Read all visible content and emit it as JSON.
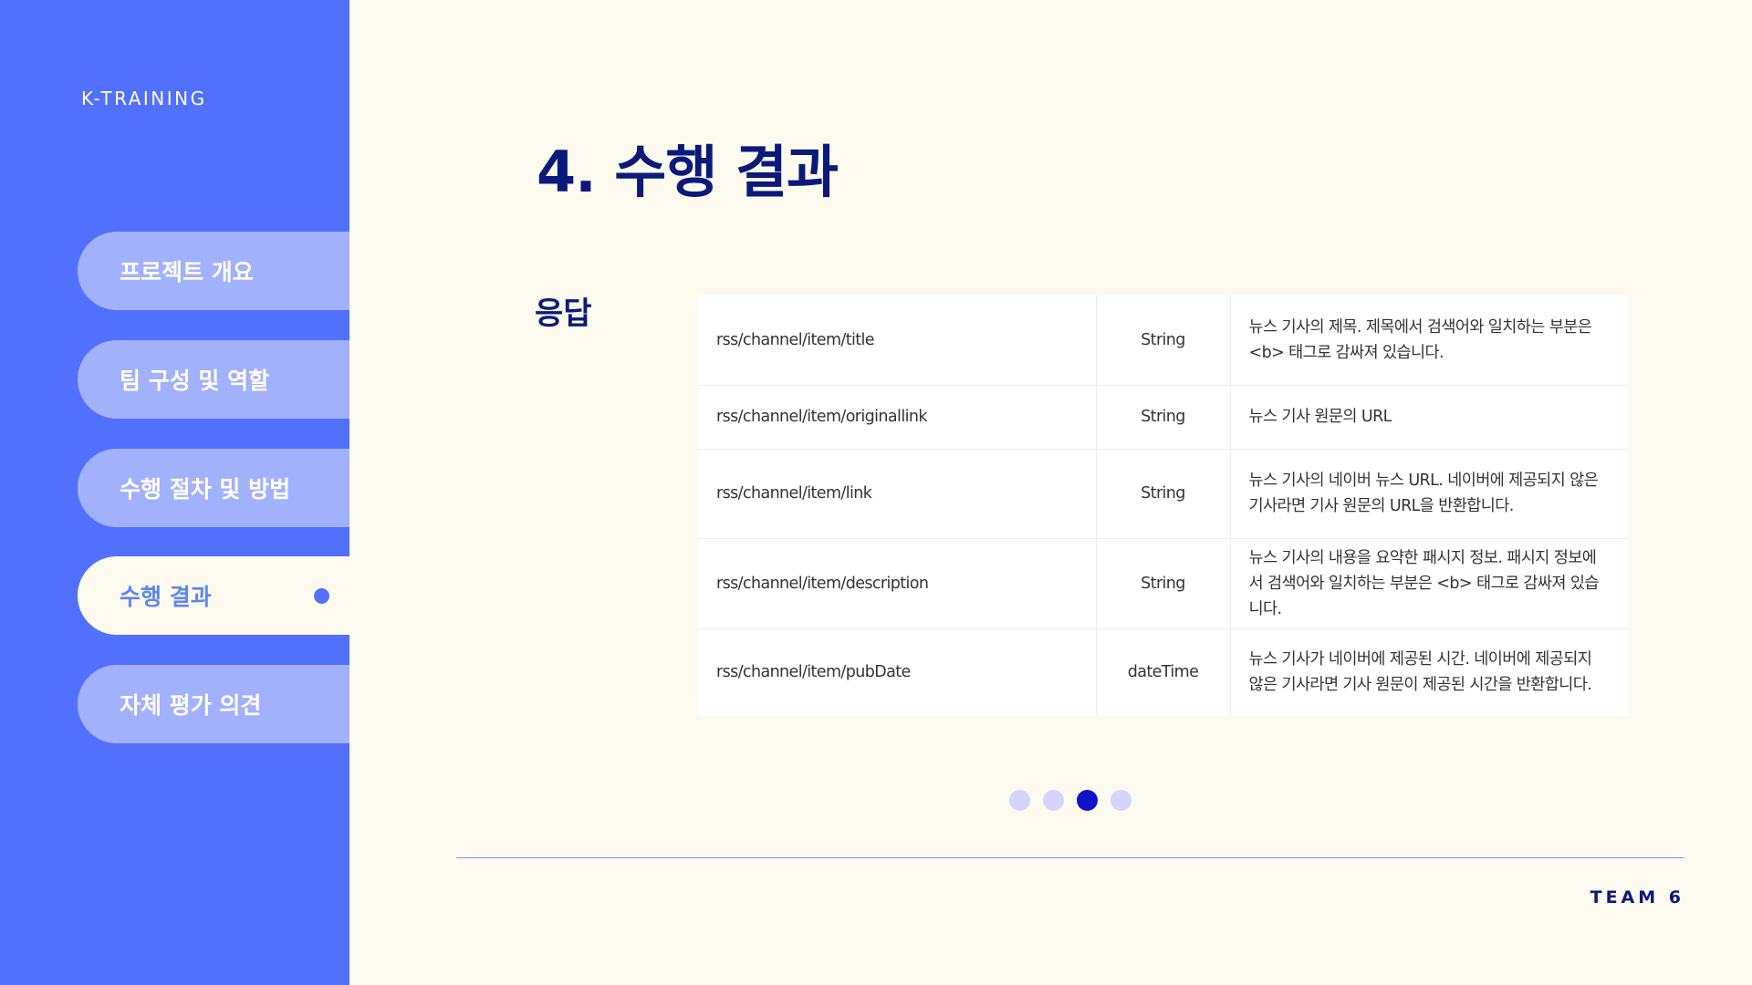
{
  "brand": "K-TRAINING",
  "nav": {
    "items": [
      {
        "label": "프로젝트 개요"
      },
      {
        "label": "팀 구성 및 역할"
      },
      {
        "label": "수행 절차 및 방법"
      },
      {
        "label": "수행 결과"
      },
      {
        "label": "자체 평가 의견"
      }
    ],
    "active_index": 3
  },
  "title": "4. 수행 결과",
  "subtitle": "응답",
  "table": {
    "rows": [
      {
        "path": "rss/channel/item/title",
        "type": "String",
        "desc": "뉴스 기사의 제목. 제목에서 검색어와 일치하는 부분은 <b> 태그로 감싸져 있습니다."
      },
      {
        "path": "rss/channel/item/originallink",
        "type": "String",
        "desc": "뉴스 기사 원문의 URL"
      },
      {
        "path": "rss/channel/item/link",
        "type": "String",
        "desc": "뉴스 기사의 네이버 뉴스 URL. 네이버에 제공되지 않은 기사라면 기사 원문의 URL을 반환합니다."
      },
      {
        "path": "rss/channel/item/description",
        "type": "String",
        "desc": "뉴스 기사의 내용을 요약한 패시지 정보. 패시지 정보에서 검색어와 일치하는 부분은 <b> 태그로 감싸져 있습니다."
      },
      {
        "path": "rss/channel/item/pubDate",
        "type": "dateTime",
        "desc": "뉴스 기사가 네이버에 제공된 시간. 네이버에 제공되지 않은 기사라면 기사 원문이 제공된 시간을 반환합니다."
      }
    ]
  },
  "pagination": {
    "total": 4,
    "current": 3
  },
  "footer": {
    "team": "TEAM 6"
  },
  "colors": {
    "sidebar": "#5170FD",
    "background": "#FCF9EE",
    "heading": "#0A1A7A",
    "nav_inactive": "#A2B1FB",
    "nav_active_text": "#5F86F2",
    "dot_active": "#0F13C8",
    "dot_inactive": "#D4D5FA"
  }
}
